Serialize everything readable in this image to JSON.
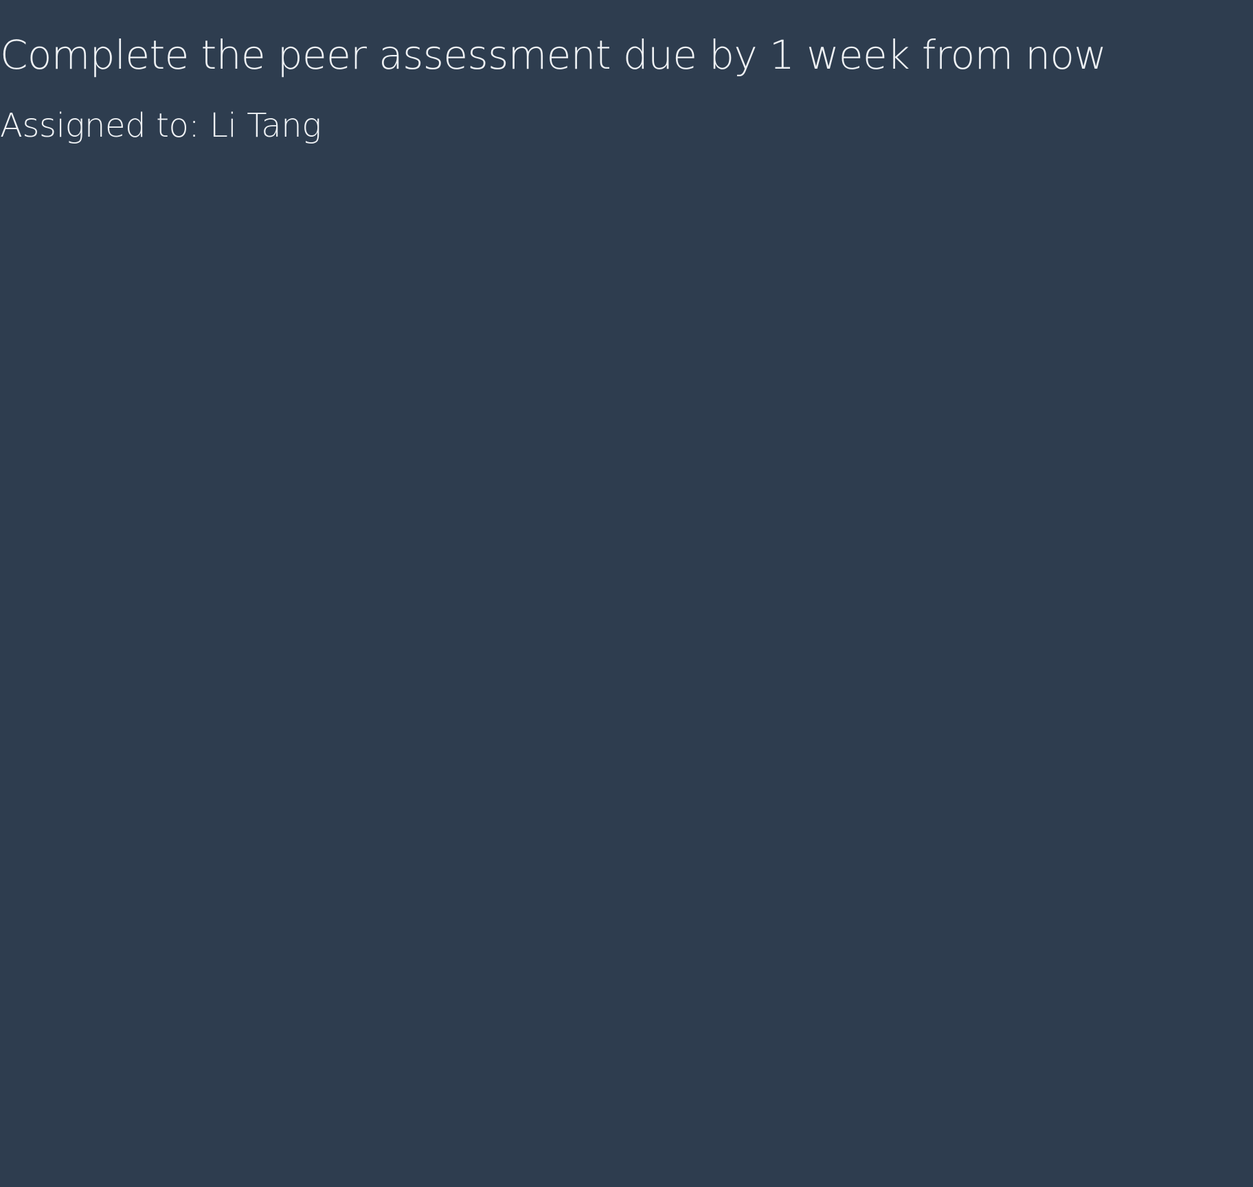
{
  "theme": {
    "background": "#2e3d4f",
    "text": "#eef1f4"
  },
  "task": {
    "title": "Complete the peer assessment due by 1 week from now",
    "assignee": "Assigned to: Li Tang"
  }
}
